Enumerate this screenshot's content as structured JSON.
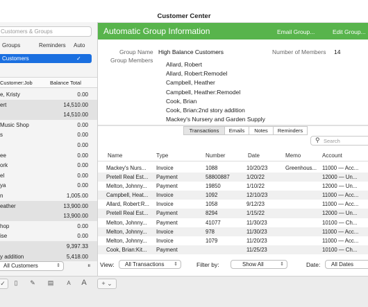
{
  "window": {
    "title": "Customer Center"
  },
  "left_panel": {
    "search_placeholder": "Customers & Groups",
    "groups_header": {
      "col1": "Groups",
      "col2": "Reminders",
      "col3": "Auto"
    },
    "selected_group": {
      "label": "Customers",
      "check": "✓"
    },
    "list_header": {
      "col1": "Customer:Job",
      "col2": "Balance Total"
    },
    "customers": [
      {
        "name": "e, Kristy",
        "balance": "0.00"
      },
      {
        "name": "ert",
        "balance": "14,510.00"
      },
      {
        "name": "",
        "balance": "14,510.00"
      },
      {
        "name": "Music Shop",
        "balance": "0.00"
      },
      {
        "name": "s",
        "balance": "0.00"
      },
      {
        "name": "",
        "balance": "0.00"
      },
      {
        "name": "ee",
        "balance": "0.00"
      },
      {
        "name": "ork",
        "balance": "0.00"
      },
      {
        "name": "el",
        "balance": "0.00"
      },
      {
        "name": "ya",
        "balance": "0.00"
      },
      {
        "name": "n",
        "balance": "1,005.00"
      },
      {
        "name": "eather",
        "balance": "13,900.00"
      },
      {
        "name": "",
        "balance": "13,900.00"
      },
      {
        "name": "hop",
        "balance": "0.00"
      },
      {
        "name": "ise",
        "balance": "0.00"
      },
      {
        "name": "",
        "balance": "9,397.33"
      },
      {
        "name": "y addition",
        "balance": "5,418.00"
      }
    ],
    "filter_select": "All Customers"
  },
  "group_info": {
    "banner_title": "Automatic Group Information",
    "email_group": "Email Group...",
    "edit_group": "Edit Group...",
    "group_name_label": "Group Name",
    "group_name_value": "High Balance Customers",
    "members_count_label": "Number of Members",
    "members_count_value": "14",
    "group_members_label": "Group Members",
    "members": [
      "Allard, Robert",
      "Allard, Robert:Remodel",
      "Campbell, Heather",
      "Campbell, Heather:Remodel",
      "Cook, Brian",
      "Cook, Brian:2nd story addition",
      "Mackey's Nursery and Garden Supply"
    ]
  },
  "transactions": {
    "tabs": [
      "Transactions",
      "Emails",
      "Notes",
      "Reminders"
    ],
    "search_placeholder": "Search",
    "columns": [
      "Name",
      "Type",
      "Number",
      "Date",
      "Memo",
      "Account"
    ],
    "rows": [
      {
        "name": "Mackey's Nurs...",
        "type": "Invoice",
        "number": "1088",
        "date": "10/20/23",
        "memo": "Greenhous...",
        "account": "11000 — Acc..."
      },
      {
        "name": "Pretell Real Est...",
        "type": "Payment",
        "number": "58800887",
        "date": "1/20/22",
        "memo": "",
        "account": "12000 — Un..."
      },
      {
        "name": "Melton, Johnny...",
        "type": "Payment",
        "number": "19850",
        "date": "1/10/22",
        "memo": "",
        "account": "12000 — Un..."
      },
      {
        "name": "Campbell, Heat...",
        "type": "Invoice",
        "number": "1092",
        "date": "12/10/23",
        "memo": "",
        "account": "11000 — Acc..."
      },
      {
        "name": "Allard, Robert:R...",
        "type": "Invoice",
        "number": "1058",
        "date": "9/12/23",
        "memo": "",
        "account": "11000 — Acc..."
      },
      {
        "name": "Pretell Real Est...",
        "type": "Payment",
        "number": "8294",
        "date": "1/15/22",
        "memo": "",
        "account": "12000 — Un..."
      },
      {
        "name": "Melton, Johnny...",
        "type": "Payment",
        "number": "41077",
        "date": "11/30/23",
        "memo": "",
        "account": "10100 — Ch..."
      },
      {
        "name": "Melton, Johnny...",
        "type": "Invoice",
        "number": "978",
        "date": "11/30/23",
        "memo": "",
        "account": "11000 — Acc..."
      },
      {
        "name": "Melton, Johnny...",
        "type": "Invoice",
        "number": "1079",
        "date": "11/20/23",
        "memo": "",
        "account": "11000 — Acc..."
      },
      {
        "name": "Cook, Brian:Kit...",
        "type": "Payment",
        "number": "",
        "date": "11/25/23",
        "memo": "",
        "account": "10100 — Ch..."
      }
    ],
    "footer": {
      "view_label": "View:",
      "view_value": "All Transactions",
      "filter_label": "Filter by:",
      "filter_value": "Show All",
      "date_label": "Date:",
      "date_value": "All Dates"
    }
  },
  "bottom_toolbar": {
    "icons": [
      "checkmark-icon",
      "document-icon",
      "pencil-icon",
      "table-icon",
      "font-small-icon",
      "font-large-icon",
      "add-menu-icon"
    ],
    "add_label": "+ ⌄"
  }
}
